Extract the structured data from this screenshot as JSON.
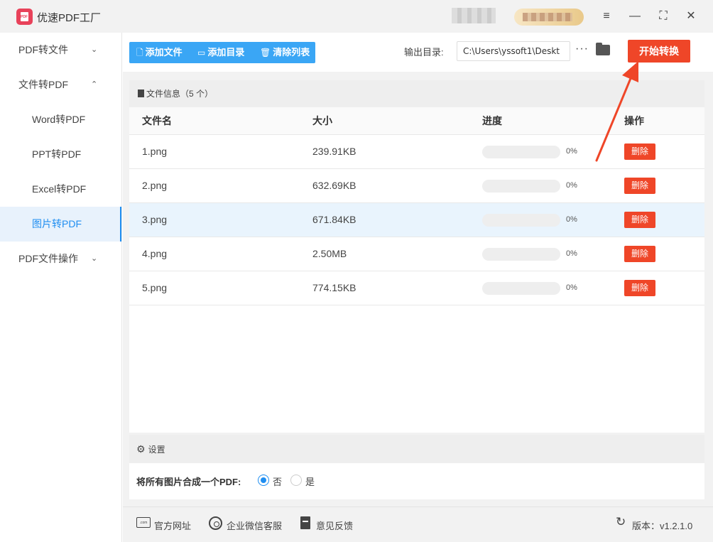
{
  "app": {
    "title": "优速PDF工厂",
    "logo_text": "PDF"
  },
  "window": {
    "menu_icon": "≡",
    "minimize_icon": "—",
    "maximize_icon": "⛶",
    "close_icon": "✕"
  },
  "sidebar": {
    "items": [
      {
        "label": "PDF转文件",
        "chevron": "⌄"
      },
      {
        "label": "文件转PDF",
        "chevron": "⌃"
      },
      {
        "label": "Word转PDF"
      },
      {
        "label": "PPT转PDF"
      },
      {
        "label": "Excel转PDF"
      },
      {
        "label": "图片转PDF"
      },
      {
        "label": "PDF文件操作",
        "chevron": "⌄"
      }
    ]
  },
  "toolbar": {
    "add_file": "添加文件",
    "add_dir": "添加目录",
    "clear_list": "清除列表",
    "output_label": "输出目录:",
    "output_path": "C:\\Users\\yssoft1\\Deskt",
    "more": "···",
    "start": "开始转换"
  },
  "file_info": {
    "title": "文件信息（5 个）",
    "columns": {
      "name": "文件名",
      "size": "大小",
      "progress": "进度",
      "action": "操作"
    },
    "rows": [
      {
        "name": "1.png",
        "size": "239.91KB",
        "progress": 0,
        "progress_text": "0%",
        "action": "删除"
      },
      {
        "name": "2.png",
        "size": "632.69KB",
        "progress": 0,
        "progress_text": "0%",
        "action": "删除"
      },
      {
        "name": "3.png",
        "size": "671.84KB",
        "progress": 0,
        "progress_text": "0%",
        "action": "删除"
      },
      {
        "name": "4.png",
        "size": "2.50MB",
        "progress": 0,
        "progress_text": "0%",
        "action": "删除"
      },
      {
        "name": "5.png",
        "size": "774.15KB",
        "progress": 0,
        "progress_text": "0%",
        "action": "删除"
      }
    ]
  },
  "settings": {
    "title": "设置",
    "merge_label": "将所有图片合成一个PDF:",
    "option_no": "否",
    "option_yes": "是",
    "selected": "否"
  },
  "footer": {
    "website": "官方网址",
    "wechat": "企业微信客服",
    "feedback": "意见反馈",
    "version": "版本：v1.2.1.0",
    "com_icon_text": ".com"
  },
  "colors": {
    "accent_blue": "#3aa6f5",
    "active_blue": "#1f8ef1",
    "danger_red": "#ef4628",
    "logo_pink": "#e8425a"
  }
}
